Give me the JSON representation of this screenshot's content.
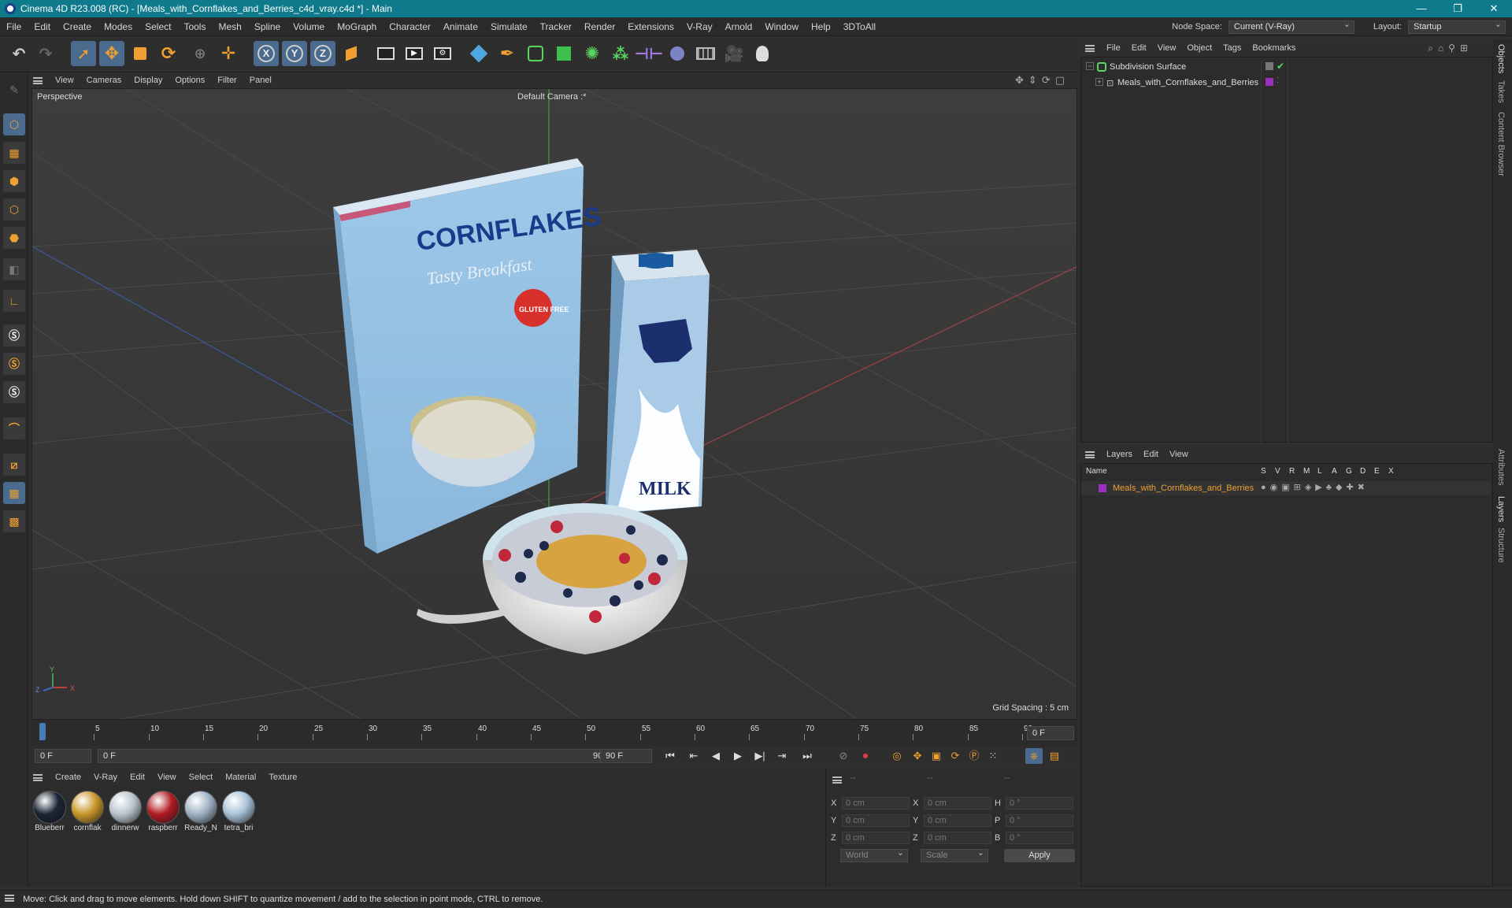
{
  "window": {
    "title": "Cinema 4D R23.008 (RC) - [Meals_with_Cornflakes_and_Berries_c4d_vray.c4d *] - Main",
    "controls": [
      "—",
      "❐",
      "✕"
    ]
  },
  "menubar": {
    "items": [
      "File",
      "Edit",
      "Create",
      "Modes",
      "Select",
      "Tools",
      "Mesh",
      "Spline",
      "Volume",
      "MoGraph",
      "Character",
      "Animate",
      "Simulate",
      "Tracker",
      "Render",
      "Extensions",
      "V-Ray",
      "Arnold",
      "Window",
      "Help",
      "3DToAll"
    ],
    "node_space_label": "Node Space:",
    "node_space_value": "Current (V-Ray)",
    "layout_label": "Layout:",
    "layout_value": "Startup"
  },
  "viewport": {
    "menu": [
      "View",
      "Cameras",
      "Display",
      "Options",
      "Filter",
      "Panel"
    ],
    "label": "Perspective",
    "camera": "Default Camera :*",
    "grid_spacing": "Grid Spacing : 5 cm",
    "scene": {
      "box_title": "CORNFLAKES",
      "box_subtitle": "Tasty Breakfast",
      "box_badge": "GLUTEN FREE",
      "carton_text": "MILK"
    },
    "axis_labels": {
      "y": "Y",
      "z": "Z",
      "x": "X"
    }
  },
  "timeline": {
    "ticks": [
      "0",
      "5",
      "10",
      "15",
      "20",
      "25",
      "30",
      "35",
      "40",
      "45",
      "50",
      "55",
      "60",
      "65",
      "70",
      "75",
      "80",
      "85",
      "90"
    ],
    "frame_field": "0 F",
    "current_frame": "0 F",
    "range_start": "0 F",
    "range_end": "90 F",
    "max_frame": "90 F"
  },
  "materials": {
    "menu": [
      "Create",
      "V-Ray",
      "Edit",
      "View",
      "Select",
      "Material",
      "Texture"
    ],
    "items": [
      {
        "name": "Blueberr",
        "color": "#1b2535"
      },
      {
        "name": "cornflak",
        "color": "#c8962a"
      },
      {
        "name": "dinnerw",
        "color": "#b8c4cc"
      },
      {
        "name": "raspberr",
        "color": "#b01c24"
      },
      {
        "name": "Ready_N",
        "color": "#9fb2c4"
      },
      {
        "name": "tetra_bri",
        "color": "#a8c2d8"
      }
    ]
  },
  "coords": {
    "headers": [
      "--",
      "--",
      "--"
    ],
    "rows": [
      {
        "a": "X",
        "av": "0 cm",
        "b": "X",
        "bv": "0 cm",
        "c": "H",
        "cv": "0 °"
      },
      {
        "a": "Y",
        "av": "0 cm",
        "b": "Y",
        "bv": "0 cm",
        "c": "P",
        "cv": "0 °"
      },
      {
        "a": "Z",
        "av": "0 cm",
        "b": "Z",
        "bv": "0 cm",
        "c": "B",
        "cv": "0 °"
      }
    ],
    "mode1": "World",
    "mode2": "Scale",
    "apply": "Apply"
  },
  "objects": {
    "menu": [
      "File",
      "Edit",
      "View",
      "Object",
      "Tags",
      "Bookmarks"
    ],
    "tree": [
      {
        "label": "Subdivision Surface"
      },
      {
        "label": "Meals_with_Cornflakes_and_Berries"
      }
    ]
  },
  "layers": {
    "menu": [
      "Layers",
      "Edit",
      "View"
    ],
    "col_name": "Name",
    "flags": [
      "S",
      "V",
      "R",
      "M",
      "L",
      "A",
      "G",
      "D",
      "E",
      "X"
    ],
    "rows": [
      {
        "label": "Meals_with_Cornflakes_and_Berries",
        "color": "#9b30c0"
      }
    ]
  },
  "right_tabs": [
    "Objects",
    "Takes",
    "Content Browser",
    "Attributes",
    "Layers",
    "Structure"
  ],
  "status": "Move: Click and drag to move elements. Hold down SHIFT to quantize movement / add to the selection in point mode, CTRL to remove."
}
